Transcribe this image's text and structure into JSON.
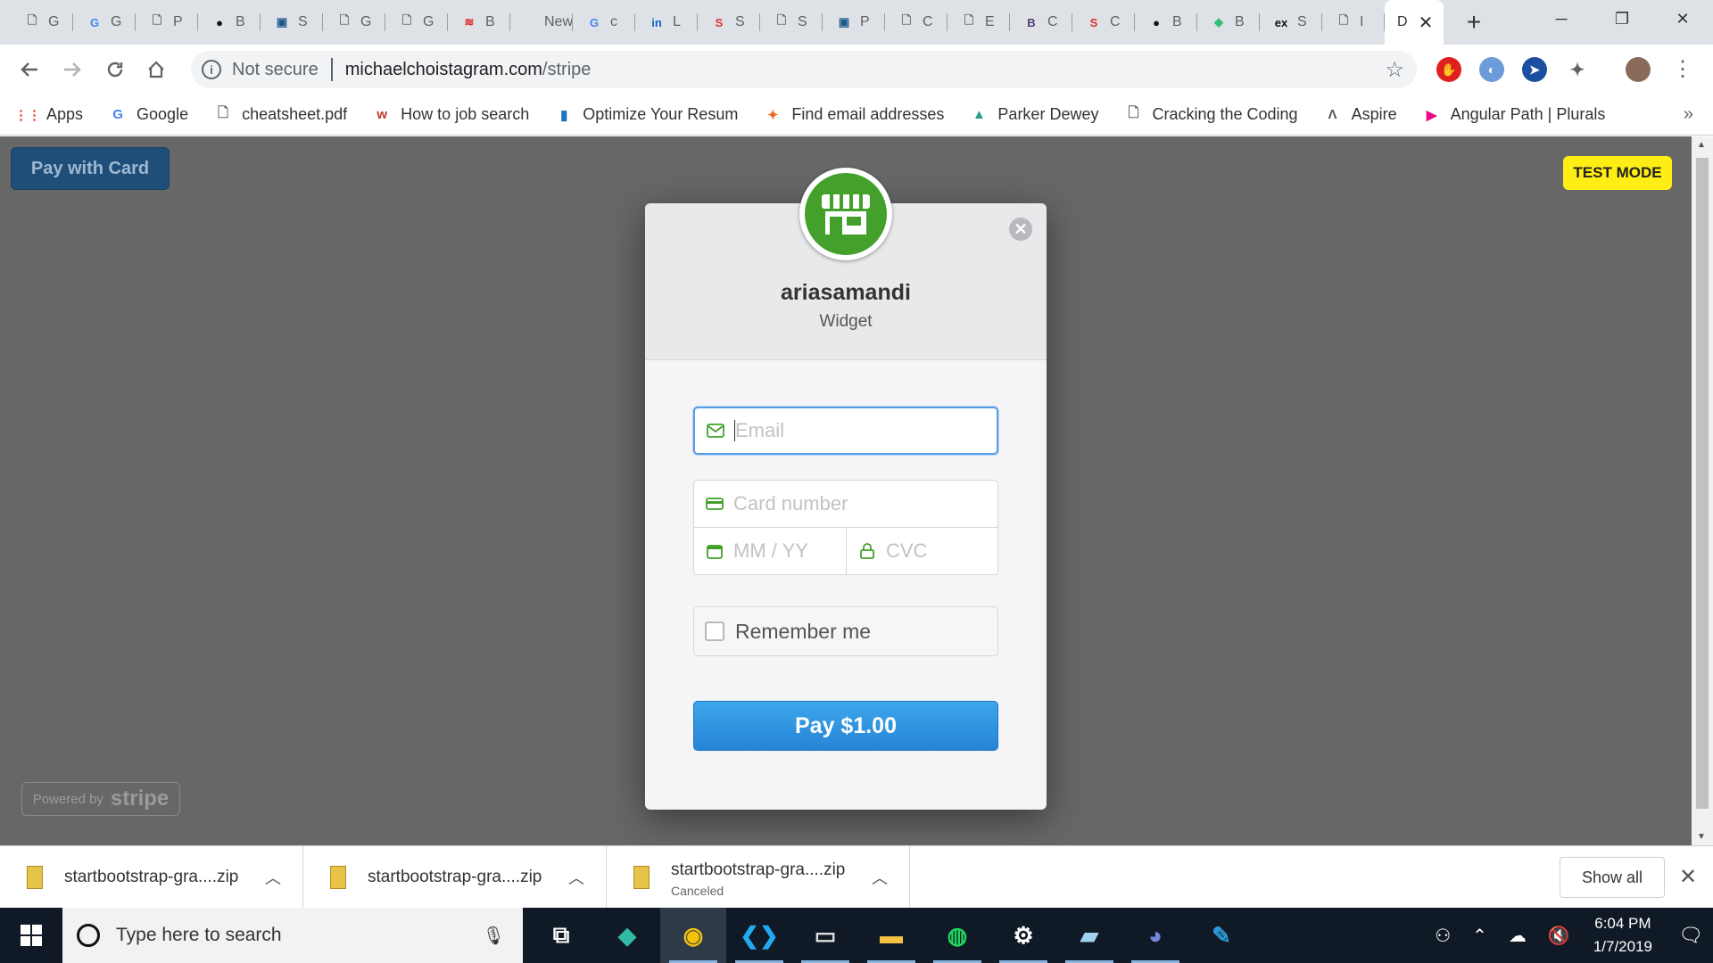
{
  "browser": {
    "tabs": [
      {
        "icon": "doc-icon",
        "title": "G"
      },
      {
        "icon": "google-icon",
        "title": "G"
      },
      {
        "icon": "doc-icon",
        "title": "P"
      },
      {
        "icon": "github-icon",
        "title": "B"
      },
      {
        "icon": "site-icon",
        "title": "S"
      },
      {
        "icon": "doc-icon",
        "title": "G"
      },
      {
        "icon": "doc-icon",
        "title": "G"
      },
      {
        "icon": "bofa-icon",
        "title": "B"
      },
      {
        "icon": "none",
        "title": "New"
      },
      {
        "icon": "google-icon",
        "title": "c"
      },
      {
        "icon": "linkedin-icon",
        "title": "L"
      },
      {
        "icon": "s-red-icon",
        "title": "S"
      },
      {
        "icon": "doc-icon",
        "title": "S"
      },
      {
        "icon": "site-icon",
        "title": "P"
      },
      {
        "icon": "doc-icon",
        "title": "C"
      },
      {
        "icon": "doc-icon",
        "title": "E"
      },
      {
        "icon": "bootstrap-icon",
        "title": "C"
      },
      {
        "icon": "s-red-icon",
        "title": "C"
      },
      {
        "icon": "github-icon",
        "title": "B"
      },
      {
        "icon": "ext-green-icon",
        "title": "B"
      },
      {
        "icon": "ex-icon",
        "title": "S"
      },
      {
        "icon": "doc-icon",
        "title": "I"
      }
    ],
    "active_tab": {
      "title": "D",
      "close": "✕"
    },
    "new_tab": "+",
    "window": {
      "minimize": "─",
      "restore": "❐",
      "close": "✕"
    },
    "security_label": "Not secure",
    "url_host": "michaelchoistagram.com",
    "url_path": "/stripe",
    "bookmarks": [
      {
        "icon": "apps-icon",
        "label": "Apps"
      },
      {
        "icon": "google-icon",
        "label": "Google"
      },
      {
        "icon": "doc-icon",
        "label": "cheatsheet.pdf"
      },
      {
        "icon": "jobsearch-icon",
        "label": "How to job search"
      },
      {
        "icon": "resume-icon",
        "label": "Optimize Your Resum"
      },
      {
        "icon": "hunter-icon",
        "label": "Find email addresses"
      },
      {
        "icon": "parker-icon",
        "label": "Parker Dewey"
      },
      {
        "icon": "doc-icon",
        "label": "Cracking the Coding"
      },
      {
        "icon": "aspire-icon",
        "label": "Aspire"
      },
      {
        "icon": "pluralsight-icon",
        "label": "Angular Path | Plurals"
      }
    ],
    "bookmarks_more": "»"
  },
  "page": {
    "pay_with_card": "Pay with Card",
    "test_mode": "TEST MODE",
    "powered_by": "Powered by",
    "stripe": "stripe"
  },
  "checkout": {
    "merchant": "ariasamandi",
    "description": "Widget",
    "close": "✕",
    "email_placeholder": "Email",
    "card_placeholder": "Card number",
    "expiry_placeholder": "MM / YY",
    "cvc_placeholder": "CVC",
    "remember_label": "Remember me",
    "pay_label": "Pay $1.00",
    "accent_color": "#43a02a",
    "button_color": "#2b8ee0"
  },
  "downloads": {
    "items": [
      {
        "name": "startbootstrap-gra....zip",
        "status": ""
      },
      {
        "name": "startbootstrap-gra....zip",
        "status": ""
      },
      {
        "name": "startbootstrap-gra....zip",
        "status": "Canceled"
      }
    ],
    "show_all": "Show all",
    "close": "✕"
  },
  "taskbar": {
    "search_placeholder": "Type here to search",
    "apps": [
      "task-view-icon",
      "gitkraken-icon",
      "chrome-icon",
      "vscode-icon",
      "terminal-icon",
      "file-explorer-icon",
      "spotify-icon",
      "settings-icon",
      "notepad-icon",
      "discord-icon",
      "lightshot-icon"
    ],
    "time": "6:04 PM",
    "date": "1/7/2019"
  }
}
